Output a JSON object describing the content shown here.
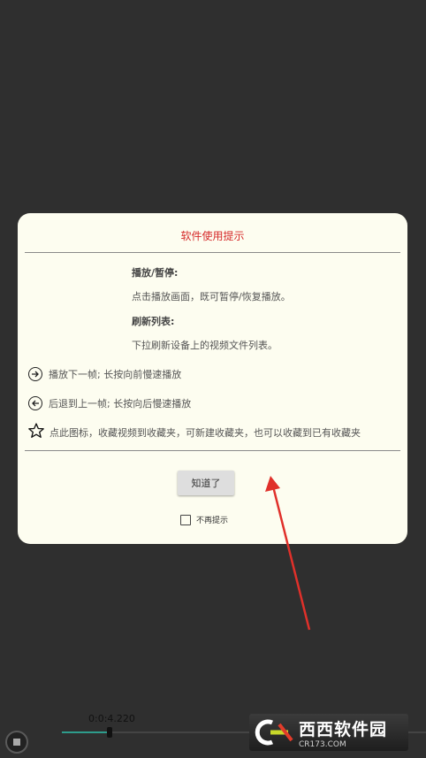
{
  "dialog": {
    "title": "软件使用提示",
    "sections": [
      {
        "heading": "播放/暂停:",
        "text": "点击播放画面，既可暂停/恢复播放。"
      },
      {
        "heading": "刷新列表:",
        "text": "下拉刷新设备上的视频文件列表。"
      }
    ],
    "hints": [
      {
        "icon": "arrow-right-circle-icon",
        "text": "播放下一帧; 长按向前慢速播放"
      },
      {
        "icon": "arrow-left-circle-icon",
        "text": "后退到上一帧; 长按向后慢速播放"
      },
      {
        "icon": "star-icon",
        "text": "点此图标，收藏视频到收藏夹，可新建收藏夹，也可以收藏到已有收藏夹"
      }
    ],
    "ok_label": "知道了",
    "dont_show_label": "不再提示",
    "dont_show_checked": false
  },
  "player": {
    "time": "0:0:4.220",
    "progress_fraction": 0.13
  },
  "watermark": {
    "brand": "西西软件园",
    "site": "CR173.COM"
  },
  "colors": {
    "title": "#d62a2a",
    "dialog_bg": "#fdfdf0",
    "annotation_arrow": "#e0302a",
    "seek_fill": "#2e9c8c"
  }
}
